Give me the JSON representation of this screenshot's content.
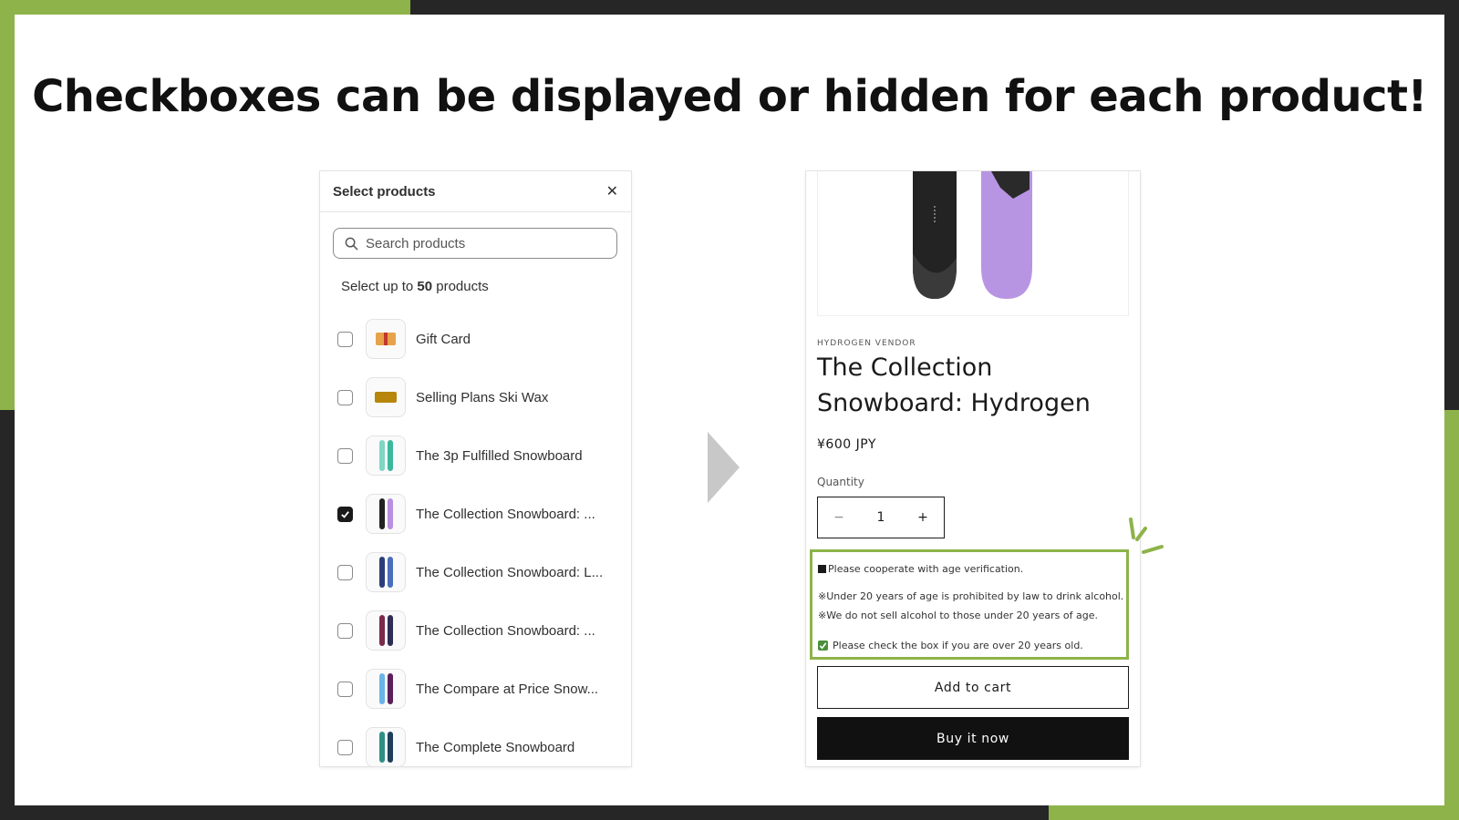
{
  "headline": "Checkboxes can be displayed or hidden for each product!",
  "colors": {
    "accent": "#8db34a",
    "dark": "#262626"
  },
  "picker": {
    "title": "Select products",
    "close_icon": "close-icon",
    "search_placeholder": "Search products",
    "limit_prefix": "Select up to ",
    "limit_number": "50",
    "limit_suffix": " products",
    "items": [
      {
        "label": "Gift Card",
        "checked": false
      },
      {
        "label": "Selling Plans Ski Wax",
        "checked": false
      },
      {
        "label": "The 3p Fulfilled Snowboard",
        "checked": false
      },
      {
        "label": "The Collection Snowboard: ...",
        "checked": true
      },
      {
        "label": "The Collection Snowboard: L...",
        "checked": false
      },
      {
        "label": "The Collection Snowboard: ...",
        "checked": false
      },
      {
        "label": "The Compare at Price Snow...",
        "checked": false
      },
      {
        "label": "The Complete Snowboard",
        "checked": false
      }
    ]
  },
  "product": {
    "vendor": "HYDROGEN VENDOR",
    "title": "The Collection Snowboard: Hydrogen",
    "price": "¥600 JPY",
    "quantity_label": "Quantity",
    "quantity_value": "1",
    "minus_symbol": "−",
    "plus_symbol": "+",
    "age_notice": "Please cooperate with age verification.",
    "age_rule_1": "※Under 20 years of age is prohibited by law to drink alcohol.",
    "age_rule_2": "※We do not sell alcohol to those under 20 years of age.",
    "age_confirm": "Please check the box if you are over 20 years old.",
    "age_confirm_checked": true,
    "add_to_cart_label": "Add to cart",
    "buy_now_label": "Buy it now"
  }
}
